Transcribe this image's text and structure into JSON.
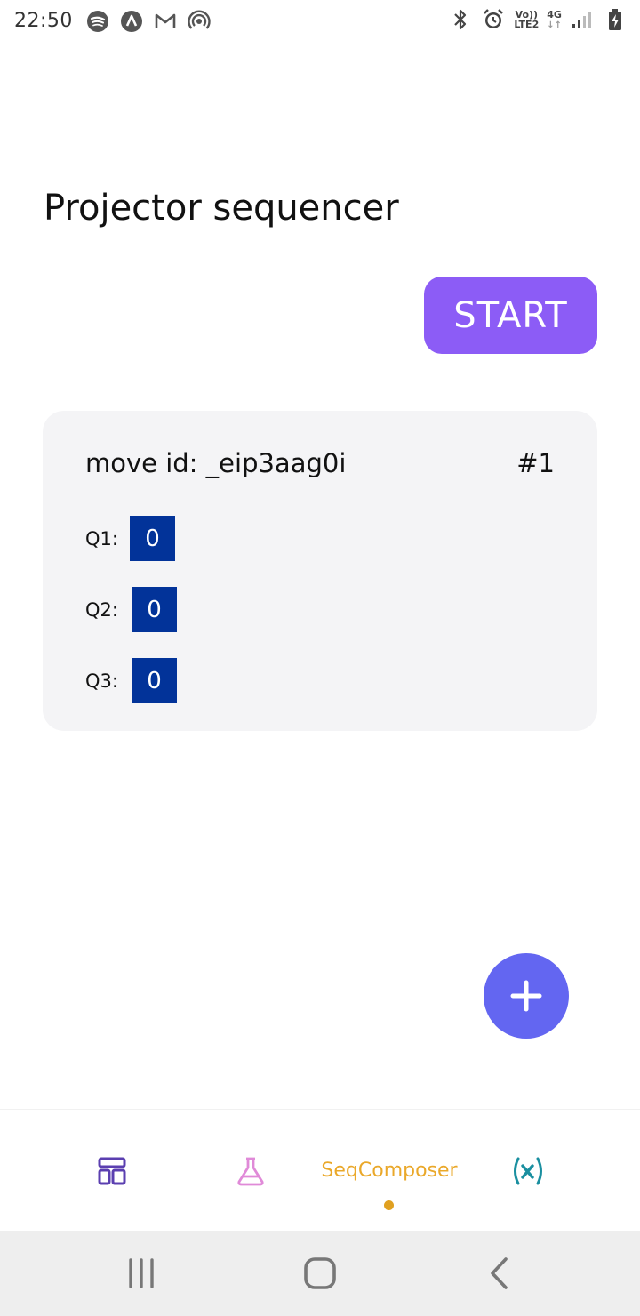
{
  "status_bar": {
    "time": "22:50",
    "left_icons": [
      "spotify-icon",
      "arc-icon",
      "gmail-icon",
      "hotspot-icon"
    ],
    "volte_label": "Vo))",
    "lte_label": "LTE2",
    "network_label": "4G",
    "right_icons": [
      "bluetooth-icon",
      "alarm-icon",
      "signal-icon",
      "battery-charging-icon"
    ]
  },
  "header": {
    "title": "Projector sequencer"
  },
  "actions": {
    "start_label": "START"
  },
  "move_card": {
    "move_id_label": "move id: _eip3aag0i",
    "index_label": "#1",
    "rows": [
      {
        "label": "Q1:",
        "value": "0"
      },
      {
        "label": "Q2:",
        "value": "0"
      },
      {
        "label": "Q3:",
        "value": "0"
      }
    ]
  },
  "fab": {
    "icon": "plus-icon"
  },
  "tab_bar": {
    "tabs": [
      {
        "icon": "layout-icon",
        "color": "#5b3fb0"
      },
      {
        "icon": "flask-icon",
        "color": "#e08ad8"
      },
      {
        "label": "SeqComposer",
        "color": "#eaa82a",
        "active": true
      },
      {
        "icon": "variable-x-icon",
        "color": "#1a8fa0"
      }
    ]
  },
  "nav_bar": {
    "buttons": [
      "recent-apps-icon",
      "home-icon",
      "back-icon"
    ]
  },
  "colors": {
    "accent": "#8c5cf6",
    "fab": "#6366f1",
    "value_box": "#023399",
    "card_bg": "#f4f4f6"
  }
}
